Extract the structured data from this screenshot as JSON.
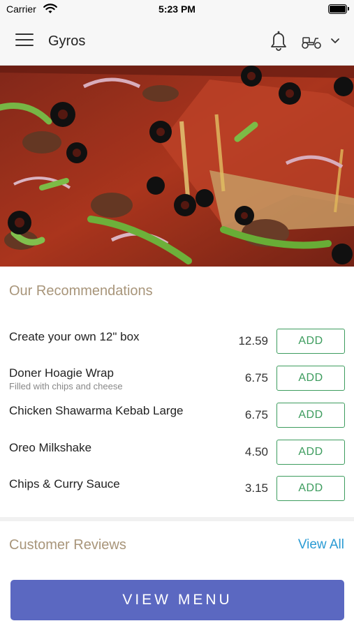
{
  "status_bar": {
    "carrier": "Carrier",
    "time": "5:23 PM"
  },
  "header": {
    "title": "Gyros",
    "icons": [
      "menu-icon",
      "bell-icon",
      "scooter-icon",
      "chevron-down-icon"
    ]
  },
  "hero": {
    "icon": "pizza-photo"
  },
  "recommendations": {
    "title": "Our Recommendations",
    "add_label": "ADD",
    "items": [
      {
        "name": "Create your own 12\" box",
        "description": "",
        "price": "12.59"
      },
      {
        "name": "Doner Hoagie Wrap",
        "description": "Filled with chips and cheese",
        "price": "6.75"
      },
      {
        "name": "Chicken Shawarma Kebab Large",
        "description": "",
        "price": "6.75"
      },
      {
        "name": "Oreo Milkshake",
        "description": "",
        "price": "4.50"
      },
      {
        "name": "Chips & Curry Sauce",
        "description": "",
        "price": "3.15"
      }
    ]
  },
  "reviews": {
    "title": "Customer Reviews",
    "view_all": "View All"
  },
  "view_menu": {
    "label": "VIEW MENU"
  },
  "colors": {
    "accent_green": "#3d9c5e",
    "section_title": "#a8957a",
    "link_blue": "#2a9bd4",
    "primary_button": "#5b68c1"
  }
}
